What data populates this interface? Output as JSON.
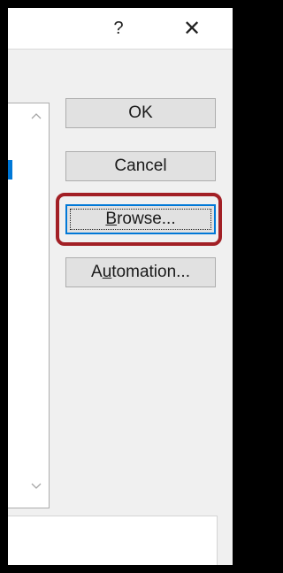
{
  "titlebar": {
    "help_glyph": "?",
    "close_glyph": "✕",
    "help_icon": "question-mark-icon",
    "close_icon": "close-icon"
  },
  "listbox": {
    "scroll_up_icon": "chevron-up-icon",
    "scroll_down_icon": "chevron-down-icon"
  },
  "buttons": {
    "ok": {
      "label": "OK"
    },
    "cancel": {
      "label": "Cancel"
    },
    "browse": {
      "label_underlined": "B",
      "label_rest": "rowse..."
    },
    "automation": {
      "label_pre": "A",
      "label_underlined": "u",
      "label_rest": "tomation..."
    }
  },
  "colors": {
    "focus_border": "#0078d7",
    "highlight_annotation": "#a21f25",
    "button_face": "#e1e1e1",
    "dialog_bg": "#f0f0f0"
  }
}
